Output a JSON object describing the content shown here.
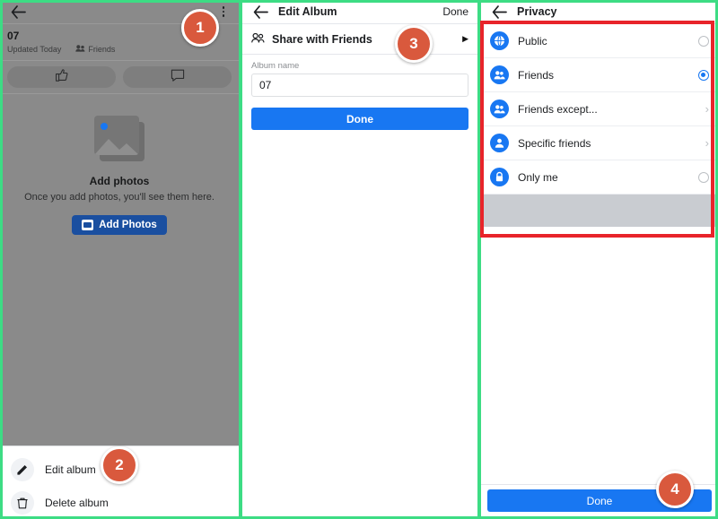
{
  "colors": {
    "accent_blue": "#1877f2",
    "badge_orange": "#d9593d",
    "highlight_red": "#e8242a",
    "panel_divider_green": "#3ddc84",
    "dim_overlay": "#8a8a8a"
  },
  "left_panel": {
    "back_icon": "back-arrow-icon",
    "menu_icon": "kebab-menu-icon",
    "album_title": "07",
    "updated_text": "Updated Today",
    "audience_text": "Friends",
    "audience_icon": "friends-icon",
    "like_icon": "thumbs-up-icon",
    "comment_icon": "comment-icon",
    "empty_state": {
      "illustration_icon": "photo-placeholder-icon",
      "title": "Add photos",
      "subtitle": "Once you add photos, you'll see them here.",
      "button_label": "Add Photos",
      "button_icon": "photo-icon"
    },
    "bottom_sheet": {
      "items": [
        {
          "label": "Edit album",
          "icon": "pencil-icon"
        },
        {
          "label": "Delete album",
          "icon": "trash-icon"
        }
      ]
    }
  },
  "middle_panel": {
    "back_icon": "back-arrow-icon",
    "title": "Edit Album",
    "done_action": "Done",
    "share_row": {
      "icon": "friends-icon",
      "label": "Share with Friends",
      "caret": "▶"
    },
    "album_name_label": "Album name",
    "album_name_value": "07",
    "album_name_placeholder": "Album name",
    "done_button": "Done"
  },
  "right_panel": {
    "back_icon": "back-arrow-icon",
    "title": "Privacy",
    "options": [
      {
        "label": "Public",
        "icon": "globe-icon",
        "control": "radio",
        "selected": false
      },
      {
        "label": "Friends",
        "icon": "friends-icon",
        "control": "radio",
        "selected": true
      },
      {
        "label": "Friends except...",
        "icon": "friends-icon",
        "control": "chevron",
        "selected": false
      },
      {
        "label": "Specific friends",
        "icon": "person-icon",
        "control": "chevron",
        "selected": false
      },
      {
        "label": "Only me",
        "icon": "lock-icon",
        "control": "radio",
        "selected": false
      }
    ],
    "done_button": "Done"
  },
  "badges": [
    {
      "number": "1"
    },
    {
      "number": "2"
    },
    {
      "number": "3"
    },
    {
      "number": "4"
    }
  ]
}
